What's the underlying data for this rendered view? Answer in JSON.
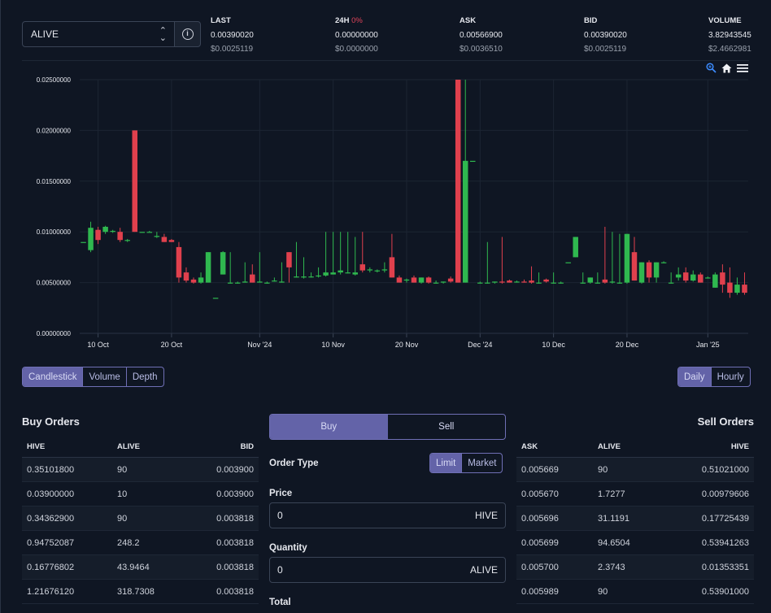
{
  "market": {
    "symbol": "ALIVE"
  },
  "stats": {
    "last": {
      "label": "LAST",
      "value": "0.00390020",
      "usd": "$0.0025119"
    },
    "change": {
      "label": "24H",
      "pct": "0%",
      "value": "0.00000000",
      "usd": "$0.0000000"
    },
    "ask": {
      "label": "ASK",
      "value": "0.00566900",
      "usd": "$0.0036510"
    },
    "bid": {
      "label": "BID",
      "value": "0.00390020",
      "usd": "$0.0025119"
    },
    "volume": {
      "label": "VOLUME",
      "value": "3.82943545",
      "usd": "$2.4662981"
    }
  },
  "colors": {
    "up": "#2fb84f",
    "down": "#e0404d",
    "accent": "#6363a8",
    "bg": "#0f1623"
  },
  "icons": [
    "zoom-icon",
    "home-icon",
    "menu-icon",
    "info-icon",
    "chevron-updown-icon"
  ],
  "chart_data": {
    "type": "candlestick",
    "y_ticks": [
      "0.02500000",
      "0.02000000",
      "0.01500000",
      "0.01000000",
      "0.00500000",
      "0.00000000"
    ],
    "ylim": [
      0,
      0.025
    ],
    "x_ticks": [
      "10 Oct",
      "20 Oct",
      "Nov '24",
      "10 Nov",
      "20 Nov",
      "Dec '24",
      "10 Dec",
      "20 Dec",
      "Jan '25"
    ],
    "x_tick_days": [
      3,
      13,
      25,
      35,
      45,
      55,
      65,
      75,
      86
    ],
    "x_range_days": [
      3,
      93
    ],
    "candles": [
      [
        1,
        0.009,
        0.009,
        0.009,
        0.009
      ],
      [
        2,
        0.0082,
        0.011,
        0.008,
        0.0104
      ],
      [
        3,
        0.0102,
        0.0105,
        0.0088,
        0.0092
      ],
      [
        4,
        0.01,
        0.0106,
        0.0098,
        0.0105
      ],
      [
        5,
        0.01,
        0.0102,
        0.0099,
        0.0101
      ],
      [
        6,
        0.01,
        0.0104,
        0.009,
        0.0092
      ],
      [
        7,
        0.0092,
        0.0093,
        0.009,
        0.0092
      ],
      [
        8,
        0.02,
        0.02,
        0.01,
        0.01
      ],
      [
        9,
        0.01,
        0.01,
        0.01,
        0.01
      ],
      [
        10,
        0.01,
        0.0101,
        0.01,
        0.01
      ],
      [
        11,
        0.0095,
        0.01,
        0.0094,
        0.0096
      ],
      [
        12,
        0.0095,
        0.0098,
        0.009,
        0.009
      ],
      [
        13,
        0.0092,
        0.0093,
        0.009,
        0.009
      ],
      [
        14,
        0.0085,
        0.009,
        0.005,
        0.0055
      ],
      [
        15,
        0.006,
        0.0065,
        0.005,
        0.0052
      ],
      [
        16,
        0.0053,
        0.0055,
        0.0049,
        0.005
      ],
      [
        17,
        0.005,
        0.006,
        0.0049,
        0.0055
      ],
      [
        18,
        0.005,
        0.008,
        0.005,
        0.008
      ],
      [
        19,
        0.0035,
        0.0035,
        0.0035,
        0.0035
      ],
      [
        20,
        0.0058,
        0.0081,
        0.0058,
        0.008
      ],
      [
        21,
        0.005,
        0.008,
        0.0049,
        0.005
      ],
      [
        22,
        0.005,
        0.0051,
        0.0049,
        0.005
      ],
      [
        23,
        0.005,
        0.007,
        0.005,
        0.0051
      ],
      [
        24,
        0.0058,
        0.0068,
        0.005,
        0.005
      ],
      [
        25,
        0.005,
        0.008,
        0.005,
        0.0051
      ],
      [
        26,
        0.005,
        0.0051,
        0.0049,
        0.005
      ],
      [
        27,
        0.0052,
        0.0055,
        0.0051,
        0.0052
      ],
      [
        28,
        0.005,
        0.007,
        0.005,
        0.0051
      ],
      [
        29,
        0.008,
        0.008,
        0.005,
        0.0065
      ],
      [
        30,
        0.0055,
        0.009,
        0.0055,
        0.0056
      ],
      [
        31,
        0.0055,
        0.0075,
        0.0054,
        0.0056
      ],
      [
        32,
        0.0056,
        0.006,
        0.0055,
        0.0056
      ],
      [
        33,
        0.0056,
        0.0065,
        0.0055,
        0.0057
      ],
      [
        34,
        0.0057,
        0.01,
        0.0056,
        0.006
      ],
      [
        35,
        0.0058,
        0.01,
        0.0058,
        0.006
      ],
      [
        36,
        0.006,
        0.01,
        0.0058,
        0.0062
      ],
      [
        37,
        0.006,
        0.01,
        0.0059,
        0.006
      ],
      [
        38,
        0.0058,
        0.0095,
        0.0057,
        0.006
      ],
      [
        39,
        0.0068,
        0.01,
        0.006,
        0.0062
      ],
      [
        40,
        0.0062,
        0.0065,
        0.006,
        0.0063
      ],
      [
        41,
        0.0062,
        0.0063,
        0.006,
        0.0062
      ],
      [
        42,
        0.0062,
        0.007,
        0.006,
        0.0063
      ],
      [
        43,
        0.0075,
        0.0098,
        0.0055,
        0.0055
      ],
      [
        44,
        0.0055,
        0.0057,
        0.005,
        0.005
      ],
      [
        45,
        0.0052,
        0.0054,
        0.005,
        0.0053
      ],
      [
        46,
        0.0055,
        0.0057,
        0.005,
        0.005
      ],
      [
        47,
        0.005,
        0.0055,
        0.0049,
        0.0055
      ],
      [
        48,
        0.0055,
        0.0056,
        0.0049,
        0.005
      ],
      [
        49,
        0.005,
        0.0052,
        0.0049,
        0.005
      ],
      [
        50,
        0.005,
        0.0051,
        0.0049,
        0.0051
      ],
      [
        51,
        0.0054,
        0.0056,
        0.005,
        0.0051
      ],
      [
        52,
        0.025,
        0.025,
        0.005,
        0.005
      ],
      [
        53,
        0.005,
        0.025,
        0.005,
        0.017
      ],
      [
        54,
        0.017,
        0.017,
        0.017,
        0.017
      ],
      [
        55,
        0.005,
        0.0051,
        0.0049,
        0.005
      ],
      [
        56,
        0.005,
        0.009,
        0.0049,
        0.005
      ],
      [
        57,
        0.005,
        0.0051,
        0.0049,
        0.0051
      ],
      [
        58,
        0.0051,
        0.0095,
        0.0049,
        0.005
      ],
      [
        59,
        0.0052,
        0.0053,
        0.005,
        0.005
      ],
      [
        60,
        0.0051,
        0.0052,
        0.005,
        0.0051
      ],
      [
        61,
        0.0051,
        0.0053,
        0.005,
        0.005
      ],
      [
        62,
        0.0052,
        0.0066,
        0.0049,
        0.005
      ],
      [
        63,
        0.005,
        0.006,
        0.0049,
        0.005
      ],
      [
        64,
        0.0053,
        0.0054,
        0.005,
        0.0051
      ],
      [
        65,
        0.005,
        0.006,
        0.0049,
        0.005
      ],
      [
        66,
        0.005,
        0.0051,
        0.0049,
        0.005
      ],
      [
        67,
        0.007,
        0.007,
        0.007,
        0.007
      ],
      [
        68,
        0.0075,
        0.0095,
        0.0075,
        0.0095
      ],
      [
        69,
        0.005,
        0.006,
        0.0049,
        0.005
      ],
      [
        70,
        0.005,
        0.0055,
        0.0049,
        0.0055
      ],
      [
        71,
        0.005,
        0.006,
        0.0049,
        0.005
      ],
      [
        72,
        0.0053,
        0.0105,
        0.0049,
        0.005
      ],
      [
        73,
        0.005,
        0.01,
        0.0049,
        0.0051
      ],
      [
        74,
        0.005,
        0.0098,
        0.0049,
        0.005
      ],
      [
        75,
        0.005,
        0.0098,
        0.0049,
        0.0098
      ],
      [
        76,
        0.008,
        0.0095,
        0.0052,
        0.0052
      ],
      [
        77,
        0.005,
        0.007,
        0.0049,
        0.007
      ],
      [
        78,
        0.007,
        0.0072,
        0.005,
        0.0055
      ],
      [
        79,
        0.0055,
        0.007,
        0.005,
        0.007
      ],
      [
        80,
        0.007,
        0.0071,
        0.0069,
        0.007
      ],
      [
        81,
        0.005,
        0.006,
        0.0049,
        0.005
      ],
      [
        82,
        0.0055,
        0.0065,
        0.0052,
        0.0058
      ],
      [
        83,
        0.006,
        0.0065,
        0.005,
        0.0052
      ],
      [
        84,
        0.0052,
        0.0062,
        0.0051,
        0.0058
      ],
      [
        85,
        0.0058,
        0.006,
        0.005,
        0.005
      ],
      [
        86,
        0.0055,
        0.0056,
        0.0054,
        0.0055
      ],
      [
        87,
        0.0045,
        0.006,
        0.0045,
        0.0058
      ],
      [
        88,
        0.006,
        0.0068,
        0.004,
        0.0048
      ],
      [
        89,
        0.005,
        0.0065,
        0.0035,
        0.004
      ],
      [
        90,
        0.004,
        0.0055,
        0.0038,
        0.0048
      ],
      [
        91,
        0.0048,
        0.006,
        0.0038,
        0.004
      ]
    ]
  },
  "chart_toggles": {
    "candlestick": "Candlestick",
    "volume": "Volume",
    "depth": "Depth",
    "daily": "Daily",
    "hourly": "Hourly"
  },
  "buy_orders": {
    "title": "Buy Orders",
    "headers": [
      "HIVE",
      "ALIVE",
      "BID"
    ],
    "rows": [
      [
        "0.35101800",
        "90",
        "0.003900"
      ],
      [
        "0.03900000",
        "10",
        "0.003900"
      ],
      [
        "0.34362900",
        "90",
        "0.003818"
      ],
      [
        "0.94752087",
        "248.2",
        "0.003818"
      ],
      [
        "0.16776802",
        "43.9464",
        "0.003818"
      ],
      [
        "1.21676120",
        "318.7308",
        "0.003818"
      ]
    ]
  },
  "sell_orders": {
    "title": "Sell Orders",
    "headers": [
      "ASK",
      "ALIVE",
      "HIVE"
    ],
    "rows": [
      [
        "0.005669",
        "90",
        "0.51021000"
      ],
      [
        "0.005670",
        "1.7277",
        "0.00979606"
      ],
      [
        "0.005696",
        "31.1191",
        "0.17725439"
      ],
      [
        "0.005699",
        "94.6504",
        "0.53941263"
      ],
      [
        "0.005700",
        "2.3743",
        "0.01353351"
      ],
      [
        "0.005989",
        "90",
        "0.53901000"
      ]
    ]
  },
  "order_form": {
    "buy_tab": "Buy",
    "sell_tab": "Sell",
    "order_type_label": "Order Type",
    "limit": "Limit",
    "market": "Market",
    "price_label": "Price",
    "price_value": "0",
    "price_unit": "HIVE",
    "quantity_label": "Quantity",
    "quantity_value": "0",
    "quantity_unit": "ALIVE",
    "total_label": "Total"
  }
}
